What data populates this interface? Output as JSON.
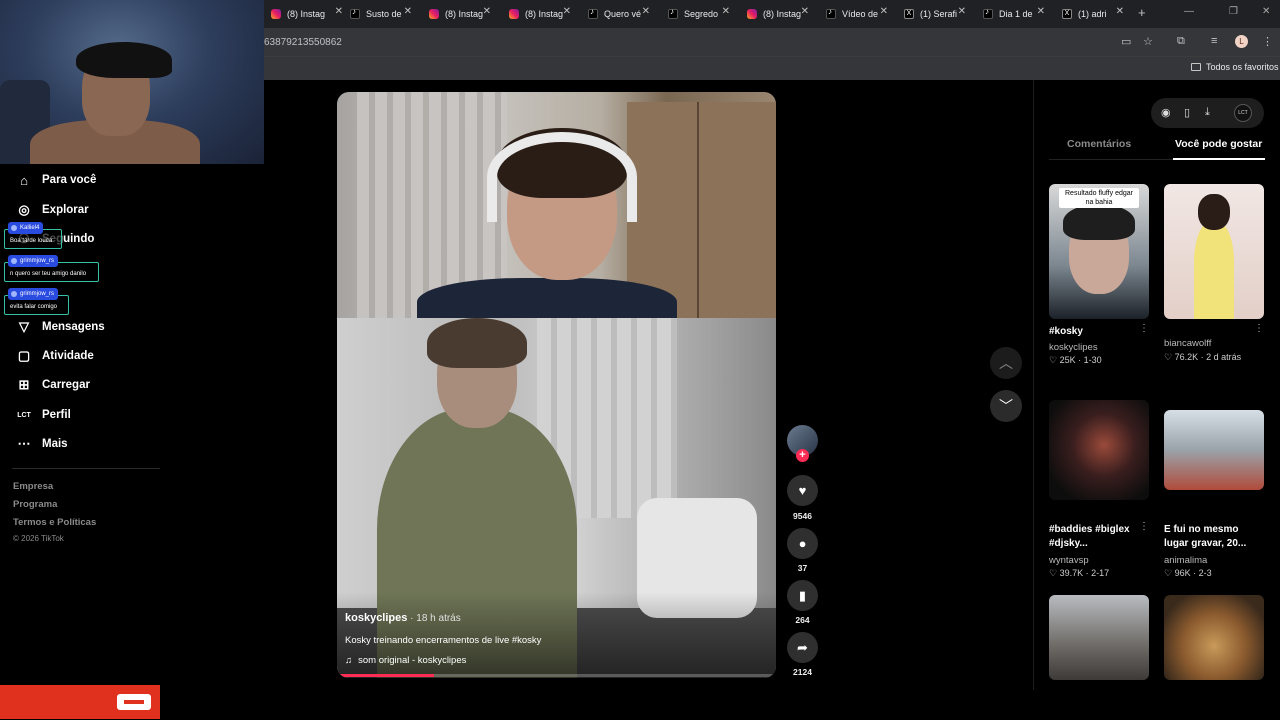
{
  "browser": {
    "tabs": [
      {
        "title": "(8) Instag",
        "kind": "ig"
      },
      {
        "title": "Susto de",
        "kind": "tt"
      },
      {
        "title": "(8) Instag",
        "kind": "ig"
      },
      {
        "title": "(8) Instag",
        "kind": "ig"
      },
      {
        "title": "Quero vé",
        "kind": "tt"
      },
      {
        "title": "Segredo",
        "kind": "tt"
      },
      {
        "title": "(8) Instag",
        "kind": "ig"
      },
      {
        "title": "Vídeo de",
        "kind": "tt"
      },
      {
        "title": "(1) Serafi",
        "kind": "x"
      },
      {
        "title": "Dia 1 de",
        "kind": "tt"
      },
      {
        "title": "(1) adri",
        "kind": "x"
      }
    ],
    "url": "63879213550862",
    "profile_initial": "L",
    "bookmarks_label": "Todos os favoritos"
  },
  "nav": {
    "items": [
      {
        "label": "Para você",
        "icon": "home-icon"
      },
      {
        "label": "Explorar",
        "icon": "compass-icon"
      },
      {
        "label": "Seguindo",
        "icon": "following-icon"
      },
      {
        "label": "Mensagens",
        "icon": "send-icon"
      },
      {
        "label": "Atividade",
        "icon": "inbox-icon"
      },
      {
        "label": "Carregar",
        "icon": "upload-icon"
      },
      {
        "label": "Perfil",
        "icon": "profile-icon"
      },
      {
        "label": "Mais",
        "icon": "more-icon"
      }
    ],
    "footer": [
      "Empresa",
      "Programa",
      "Termos e Políticas"
    ],
    "copyright": "© 2026 TikTok"
  },
  "chat_overlay": [
    {
      "user": "Kalliel4",
      "message": "Boa tarde louca"
    },
    {
      "user": "grimmjow_rs",
      "message": "n quero ser teu amigo danilo"
    },
    {
      "user": "grimmjow_rs",
      "message": "evita falar comigo"
    }
  ],
  "video": {
    "author": "koskyclipes",
    "time": " · 18 h atrás",
    "caption": "Kosky treinando encerramentos de live #kosky",
    "music": "som original - koskyclipes",
    "progress": 0.22
  },
  "actions": {
    "likes": "9546",
    "comments": "37",
    "saves": "264",
    "shares": "2124"
  },
  "right_panel": {
    "tabs": [
      "Comentários",
      "Você pode gostar"
    ],
    "active_tab": "Você pode gostar",
    "cards": [
      {
        "overlay": "Resultado fluffy edgar na bahia",
        "title": "#kosky",
        "user": "koskyclipes",
        "likes": "25K",
        "date": "1-30"
      },
      {
        "overlay": "",
        "title": "",
        "user": "biancawolff",
        "likes": "76.2K",
        "date": "2 d atrás"
      },
      {
        "overlay": "",
        "title": "#baddies #biglex #djsky...",
        "user": "wyntavsp",
        "likes": "39.7K",
        "date": "2-17"
      },
      {
        "overlay": "",
        "title": "E fui no mesmo lugar gravar, 20...",
        "user": "animalima",
        "likes": "96K",
        "date": "2-3"
      }
    ]
  }
}
